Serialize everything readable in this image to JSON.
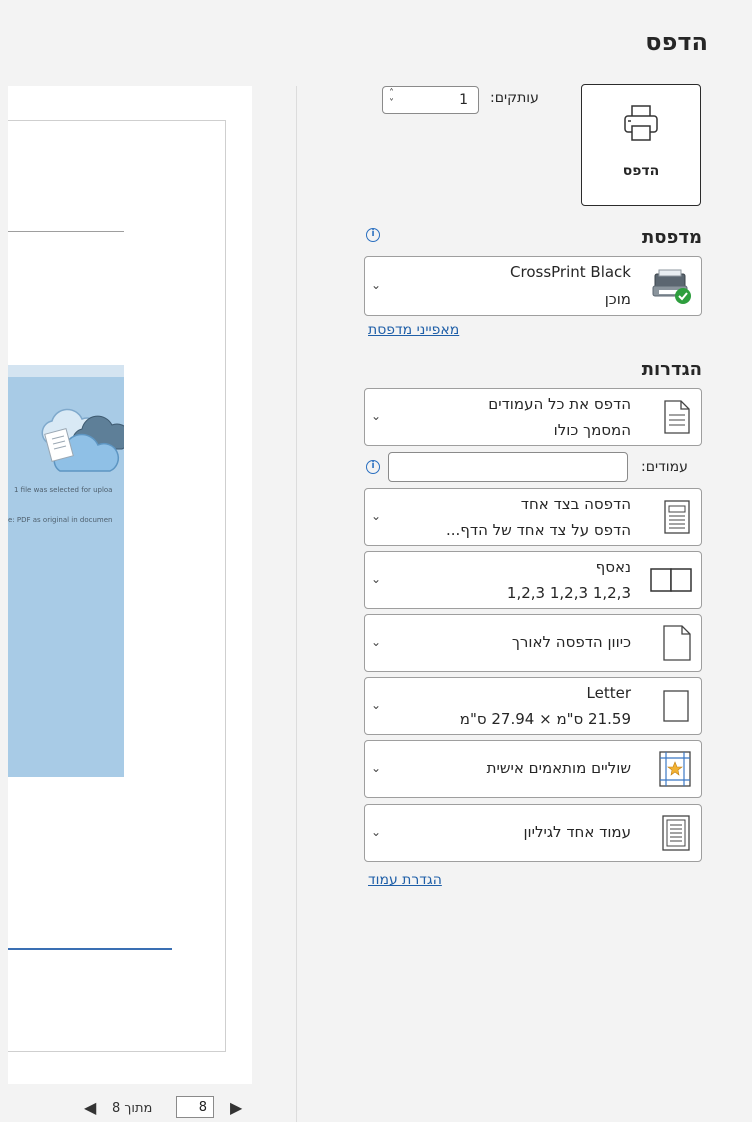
{
  "header": {
    "title": "הדפס"
  },
  "print_button": {
    "label": "הדפס",
    "icon": "printer-icon"
  },
  "copies": {
    "label": "עותקים:",
    "value": "1"
  },
  "printer": {
    "heading": "מדפסת",
    "name": "CrossPrint Black",
    "status": "מוכן",
    "properties_link": "מאפייני מדפסת"
  },
  "settings": {
    "heading": "הגדרות",
    "pages_label": "עמודים:",
    "pages_value": "",
    "items": [
      {
        "line1": "הדפס את כל העמודים",
        "line2": "המסמך כולו"
      },
      {
        "line1": "הדפסה בצד אחד",
        "line2": "הדפס על צד אחד של הדף..."
      },
      {
        "line1": "נאסף",
        "line2": "1,2,3   1,2,3   1,2,3"
      },
      {
        "line1": "כיוון הדפסה לאורך"
      },
      {
        "line1": "Letter",
        "line2": "21.59 ס\"מ × 27.94 ס\"מ"
      },
      {
        "line1": "שוליים מותאמים אישית"
      },
      {
        "line1": "עמוד אחד לגיליון"
      }
    ],
    "page_setup_link": "הגדרת עמוד"
  },
  "preview": {
    "upload_text1": "1 file was selected for uploa",
    "upload_text2": "e: PDF as original in documen"
  },
  "navigation": {
    "current_page": "8",
    "of_label": "מתוך 8"
  },
  "colors": {
    "accent": "#1f5fa8",
    "check": "#2e9e3e",
    "panel_blue": "#a8cbe6"
  }
}
